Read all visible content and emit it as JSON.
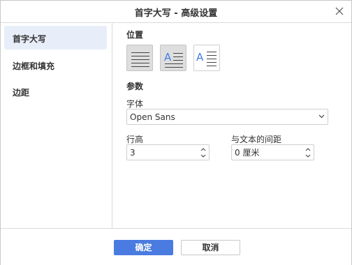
{
  "window": {
    "title": "首字大写 - 高级设置"
  },
  "sidebar": {
    "items": [
      {
        "label": "首字大写",
        "active": true
      },
      {
        "label": "边框和填充",
        "active": false
      },
      {
        "label": "边距",
        "active": false
      }
    ]
  },
  "content": {
    "position_label": "位置",
    "position_options": [
      {
        "icon": "dropcap-none-icon",
        "pressed": true
      },
      {
        "icon": "dropcap-in-text-icon",
        "pressed": true
      },
      {
        "icon": "dropcap-in-margin-icon",
        "pressed": false
      }
    ],
    "params_label": "参数",
    "font_label": "字体",
    "font_value": "Open Sans",
    "line_height_label": "行高",
    "line_height_value": "3",
    "distance_label": "与文本的间距",
    "distance_value": "0 厘米"
  },
  "footer": {
    "ok_label": "确定",
    "cancel_label": "取消"
  },
  "colors": {
    "accent": "#4a7be0",
    "active_nav": "#e8eef9",
    "dropcap_letter": "#4a7be0"
  }
}
